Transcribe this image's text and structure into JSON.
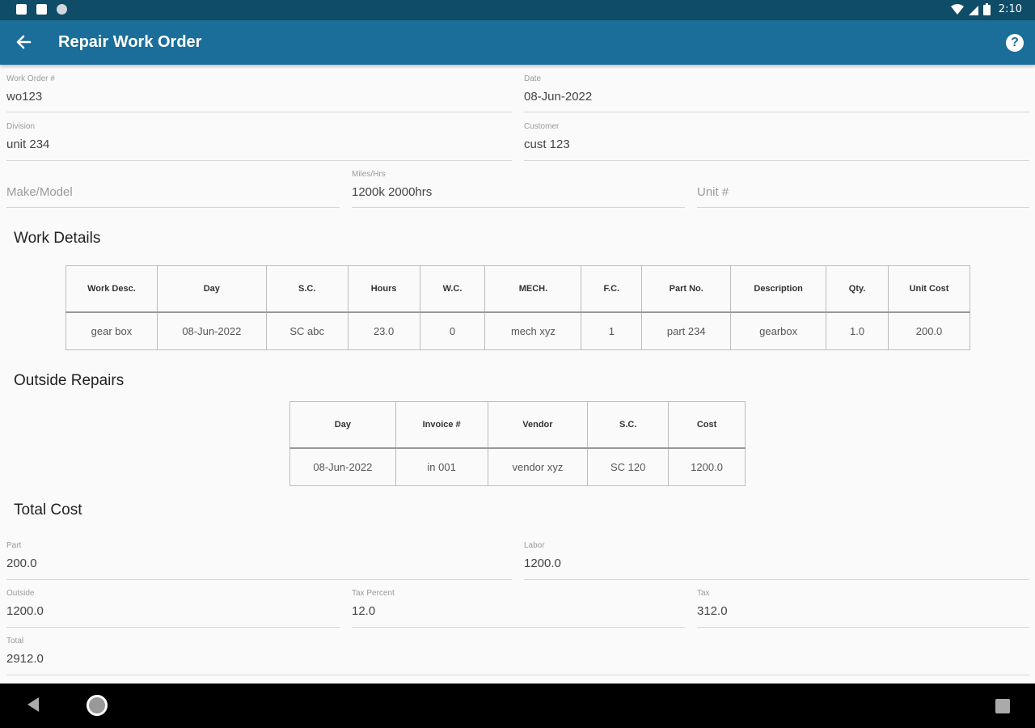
{
  "status_bar": {
    "time": "2:10"
  },
  "app_bar": {
    "title": "Repair Work Order"
  },
  "header_fields": {
    "work_order": {
      "label": "Work Order #",
      "value": "wo123"
    },
    "date": {
      "label": "Date",
      "value": "08-Jun-2022"
    },
    "division": {
      "label": "Division",
      "value": "unit 234"
    },
    "customer": {
      "label": "Customer",
      "value": "cust 123"
    },
    "make_model": {
      "placeholder": "Make/Model"
    },
    "miles_hrs": {
      "label": "Miles/Hrs",
      "value": "1200k 2000hrs"
    },
    "unit_no": {
      "placeholder": "Unit #"
    }
  },
  "work_details": {
    "title": "Work Details",
    "columns": [
      "Work Desc.",
      "Day",
      "S.C.",
      "Hours",
      "W.C.",
      "MECH.",
      "F.C.",
      "Part No.",
      "Description",
      "Qty.",
      "Unit Cost"
    ],
    "rows": [
      [
        "gear box",
        "08-Jun-2022",
        "SC abc",
        "23.0",
        "0",
        "mech xyz",
        "1",
        "part 234",
        "gearbox",
        "1.0",
        "200.0"
      ]
    ]
  },
  "outside_repairs": {
    "title": "Outside Repairs",
    "columns": [
      "Day",
      "Invoice #",
      "Vendor",
      "S.C.",
      "Cost"
    ],
    "rows": [
      [
        "08-Jun-2022",
        "in 001",
        "vendor xyz",
        "SC 120",
        "1200.0"
      ]
    ]
  },
  "total_cost": {
    "title": "Total Cost",
    "part": {
      "label": "Part",
      "value": "200.0"
    },
    "labor": {
      "label": "Labor",
      "value": "1200.0"
    },
    "outside": {
      "label": "Outside",
      "value": "1200.0"
    },
    "tax_percent": {
      "label": "Tax Percent",
      "value": "12.0"
    },
    "tax": {
      "label": "Tax",
      "value": "312.0"
    },
    "total": {
      "label": "Total",
      "value": "2912.0"
    }
  }
}
